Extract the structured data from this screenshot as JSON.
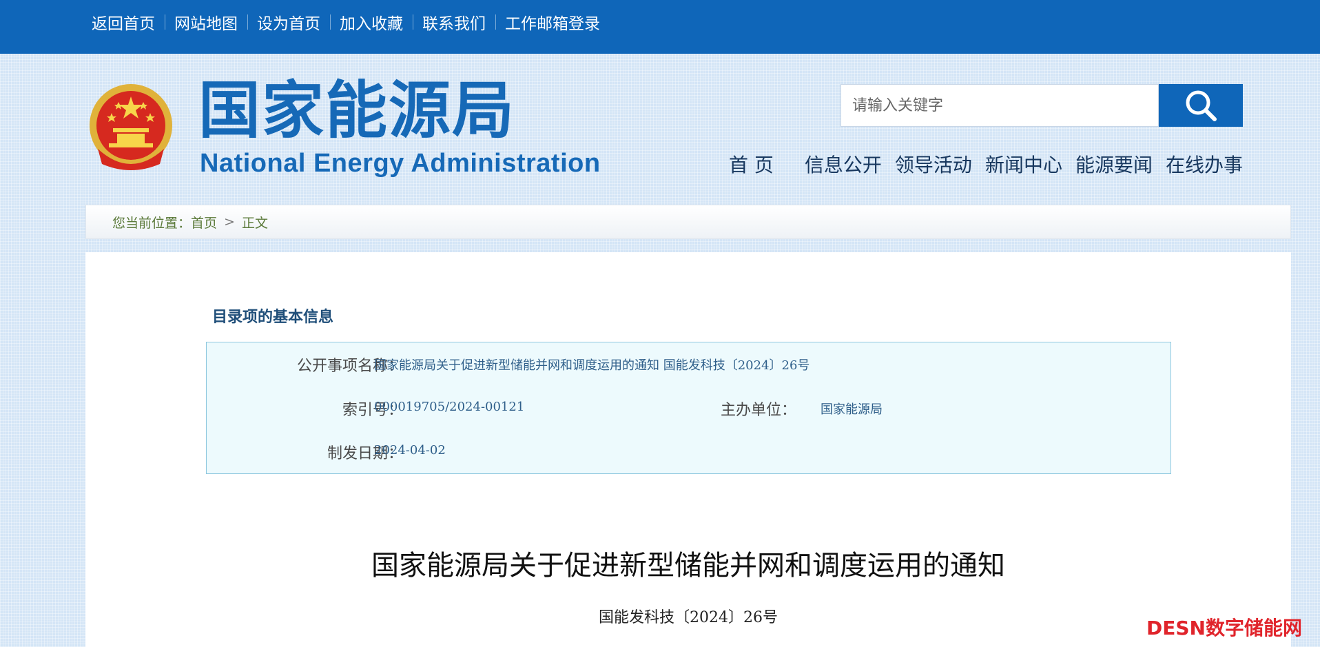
{
  "topbar": {
    "links": [
      "返回首页",
      "网站地图",
      "设为首页",
      "加入收藏",
      "联系我们",
      "工作邮箱登录"
    ]
  },
  "header": {
    "logo_cn": "国家能源局",
    "logo_en": "National Energy Administration",
    "search_placeholder": "请输入关键字",
    "nav": [
      "首 页",
      "信息公开",
      "领导活动",
      "新闻中心",
      "能源要闻",
      "在线办事"
    ]
  },
  "breadcrumb": {
    "prefix": "您当前位置：",
    "home": "首页",
    "separator": ">",
    "current": "正文"
  },
  "info": {
    "section_title": "目录项的基本信息",
    "name_label": "公开事项名称：",
    "name_value": "国家能源局关于促进新型储能并网和调度运用的通知 国能发科技〔2024〕26号",
    "index_label": "索引号：",
    "index_value": "000019705/2024-00121",
    "org_label": "主办单位：",
    "org_value": "国家能源局",
    "date_label": "制发日期：",
    "date_value": "2024-04-02"
  },
  "document": {
    "title": "国家能源局关于促进新型储能并网和调度运用的通知",
    "number": "国能发科技〔2024〕26号"
  },
  "watermark": "DESN数字储能网",
  "colors": {
    "topbar": "#0f66b9",
    "brand_blue": "#1669b7",
    "background": "#d4e5f6",
    "info_bg": "#edfafd",
    "info_border": "#8cc7de",
    "watermark_red": "#e0242b"
  },
  "icons": {
    "emblem": "national-emblem-icon",
    "search": "search-icon"
  }
}
